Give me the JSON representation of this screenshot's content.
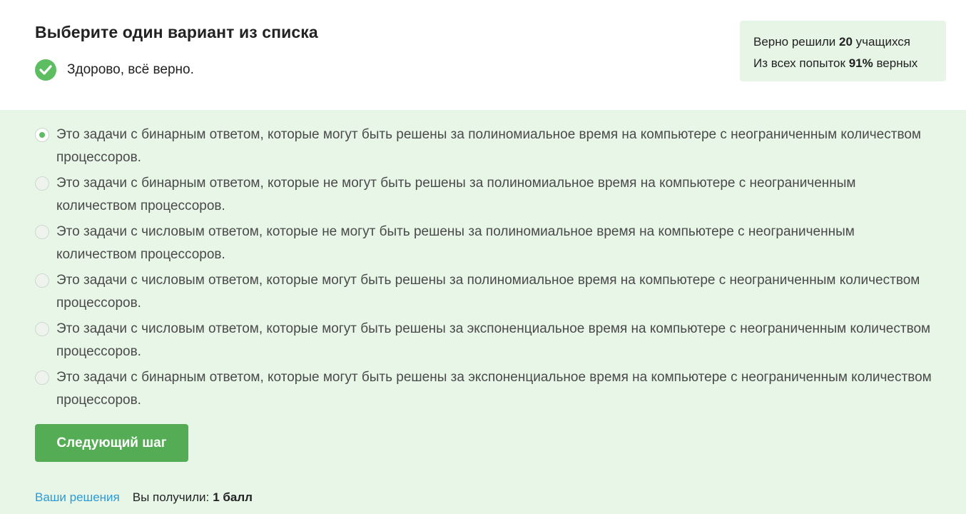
{
  "quiz": {
    "title": "Выберите один вариант из списка",
    "feedback": "Здорово, всё верно."
  },
  "stats": {
    "line1_prefix": "Верно решили",
    "line1_count": "20",
    "line1_suffix": "учащихся",
    "line2_prefix": "Из всех попыток",
    "line2_percent": "91%",
    "line2_suffix": "верных"
  },
  "options": [
    {
      "text": "Это задачи с бинарным ответом, которые могут быть решены за полиномиальное время на компьютере с неограниченным количеством процессоров.",
      "selected": true
    },
    {
      "text": "Это задачи с бинарным ответом, которые не могут быть решены за полиномиальное время на компьютере с неограниченным количеством процессоров.",
      "selected": false
    },
    {
      "text": "Это задачи с числовым ответом, которые не могут быть решены за полиномиальное время на компьютере с неограниченным количеством процессоров.",
      "selected": false
    },
    {
      "text": "Это задачи с числовым ответом, которые могут быть решены за полиномиальное время на компьютере с неограниченным количеством процессоров.",
      "selected": false
    },
    {
      "text": "Это задачи с числовым ответом, которые могут быть решены за экспоненциальное время на компьютере с неограниченным количеством процессоров.",
      "selected": false
    },
    {
      "text": "Это задачи с бинарным ответом, которые могут быть решены за экспоненциальное время на компьютере с неограниченным количеством процессоров.",
      "selected": false
    }
  ],
  "next_button": "Следующий шаг",
  "footer": {
    "solutions_link": "Ваши решения",
    "score_label": "Вы получили:",
    "score_value": "1 балл"
  },
  "colors": {
    "accent_green": "#54ad54",
    "check_green": "#5dbe61",
    "answers_bg": "#e8f6e8",
    "link_blue": "#2b9ad8"
  },
  "icons": {
    "feedback": "check-circle-icon"
  }
}
